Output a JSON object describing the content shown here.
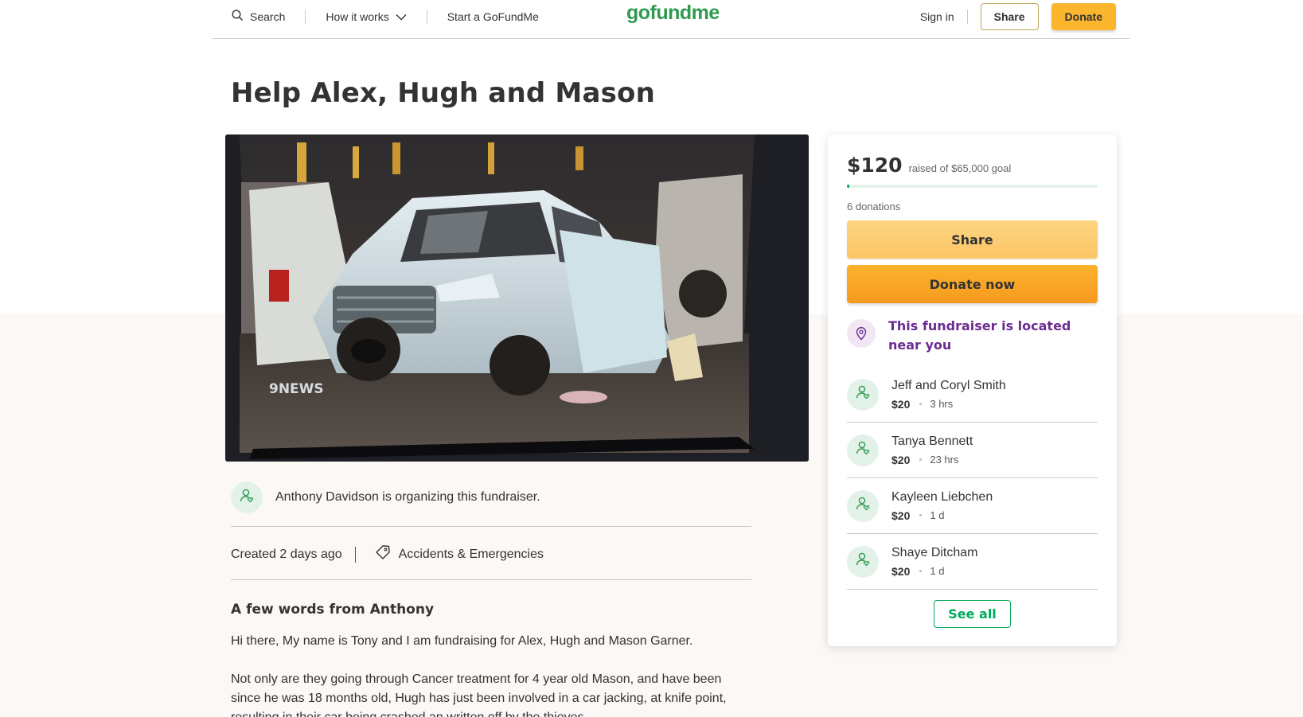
{
  "header": {
    "search_label": "Search",
    "how_it_works_label": "How it works",
    "start_label": "Start a GoFundMe",
    "logo_text": "gofundme",
    "sign_in_label": "Sign in",
    "share_label": "Share",
    "donate_label": "Donate"
  },
  "campaign": {
    "title": "Help Alex, Hugh and Mason",
    "image_watermark": "9NEWS",
    "organizer_text": "Anthony Davidson is organizing this fundraiser.",
    "created": "Created 2 days ago",
    "category": "Accidents & Emergencies",
    "story_heading": "A few words from Anthony",
    "story_paragraphs": [
      "Hi there, My name is Tony and I am fundraising for Alex, Hugh and Mason Garner.",
      "Not only are they going through Cancer treatment for 4 year old Mason, and have been since he was 18 months old, Hugh has just been involved in a car jacking, at knife point, resulting in their car being crashed an written off by the thieves."
    ]
  },
  "card": {
    "amount": "$120",
    "goal_text": "raised of $65,000 goal",
    "progress_fraction": 0.0018,
    "donations_text": "6 donations",
    "share_label": "Share",
    "donate_label": "Donate now",
    "located_text": "This fundraiser is located near you",
    "donors": [
      {
        "name": "Jeff and Coryl Smith",
        "amount": "$20",
        "time": "3 hrs"
      },
      {
        "name": "Tanya Bennett",
        "amount": "$20",
        "time": "23 hrs"
      },
      {
        "name": "Kayleen Liebchen",
        "amount": "$20",
        "time": "1 d"
      },
      {
        "name": "Shaye Ditcham",
        "amount": "$20",
        "time": "1 d"
      }
    ],
    "see_all_label": "See all"
  },
  "colors": {
    "brand_green": "#02a95c",
    "donate_orange": "#fbb62e",
    "share_yellow": "#fcd07a",
    "location_purple": "#6b2c91"
  },
  "icons": {
    "search": "search-icon",
    "chevron": "chevron-down-icon",
    "tag": "tag-icon",
    "location": "location-pin-icon",
    "user": "user-heart-icon"
  }
}
